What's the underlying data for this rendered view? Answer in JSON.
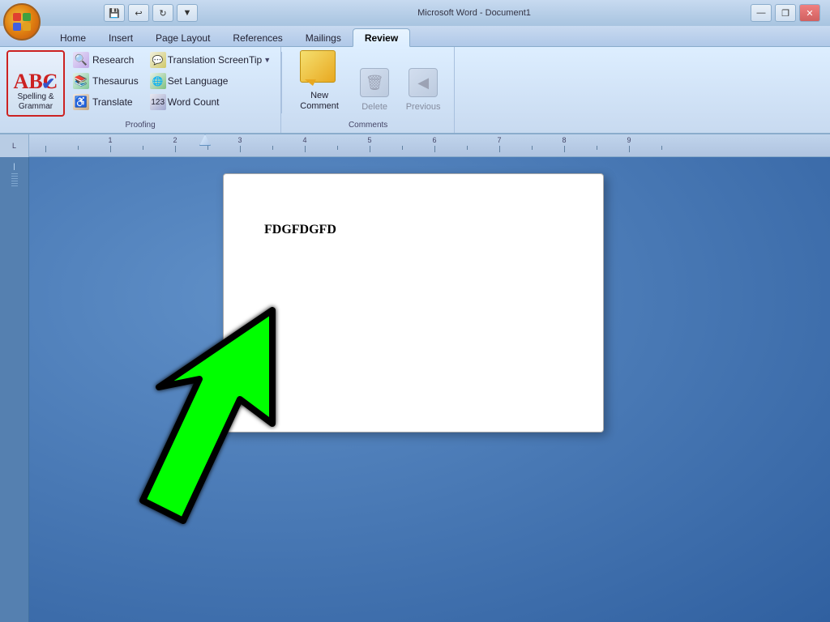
{
  "titlebar": {
    "title": "Microsoft Word - Document1",
    "qat_buttons": [
      "save",
      "undo",
      "redo",
      "customize"
    ]
  },
  "tabs": [
    {
      "label": "Home",
      "active": false
    },
    {
      "label": "Insert",
      "active": false
    },
    {
      "label": "Page Layout",
      "active": false
    },
    {
      "label": "References",
      "active": false
    },
    {
      "label": "Mailings",
      "active": false
    },
    {
      "label": "Review",
      "active": true
    }
  ],
  "ribbon": {
    "proofing_group_label": "Proofing",
    "spelling_label": "Spelling &\nGrammar",
    "research_label": "Research",
    "thesaurus_label": "Thesaurus",
    "translate_label": "Translate",
    "translation_screentip_label": "Translation ScreenTip",
    "set_language_label": "Set Language",
    "word_count_label": "Word Count",
    "comments_group_label": "Comments",
    "new_comment_label": "New\nComment",
    "delete_label": "Delete",
    "previous_label": "Previous"
  },
  "document": {
    "content": "FDGFDGFD"
  },
  "ruler": {
    "label": "L"
  }
}
